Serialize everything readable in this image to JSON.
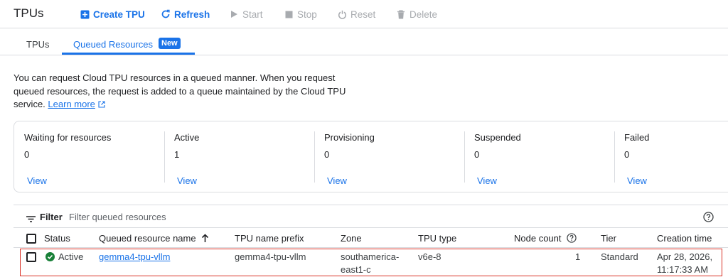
{
  "toolbar": {
    "title": "TPUs",
    "create_label": "Create TPU",
    "refresh_label": "Refresh",
    "start_label": "Start",
    "stop_label": "Stop",
    "reset_label": "Reset",
    "delete_label": "Delete"
  },
  "tabs": {
    "tpus": "TPUs",
    "queued": "Queued Resources",
    "new_badge": "New"
  },
  "description": {
    "text": "You can request Cloud TPU resources in a queued manner. When you request queued resources, the request is added to a queue maintained by the Cloud TPU service.",
    "link": "Learn more"
  },
  "summary": [
    {
      "label": "Waiting for resources",
      "count": "0",
      "view": "View"
    },
    {
      "label": "Active",
      "count": "1",
      "view": "View"
    },
    {
      "label": "Provisioning",
      "count": "0",
      "view": "View"
    },
    {
      "label": "Suspended",
      "count": "0",
      "view": "View"
    },
    {
      "label": "Failed",
      "count": "0",
      "view": "View"
    }
  ],
  "filter": {
    "label": "Filter",
    "placeholder": "Filter queued resources"
  },
  "table": {
    "headers": {
      "status": "Status",
      "name": "Queued resource name",
      "prefix": "TPU name prefix",
      "zone": "Zone",
      "type": "TPU type",
      "node_count": "Node count",
      "tier": "Tier",
      "created": "Creation time"
    },
    "rows": [
      {
        "status": "Active",
        "name": "gemma4-tpu-vllm",
        "prefix": "gemma4-tpu-vllm",
        "zone_line1": "southamerica-",
        "zone_line2": "east1-c",
        "type": "v6e-8",
        "node_count": "1",
        "tier": "Standard",
        "created_line1": "Apr 28, 2026,",
        "created_line2": "11:17:33 AM"
      }
    ]
  },
  "colors": {
    "accent": "#1a73e8",
    "success": "#188038",
    "highlight": "#d93025"
  }
}
